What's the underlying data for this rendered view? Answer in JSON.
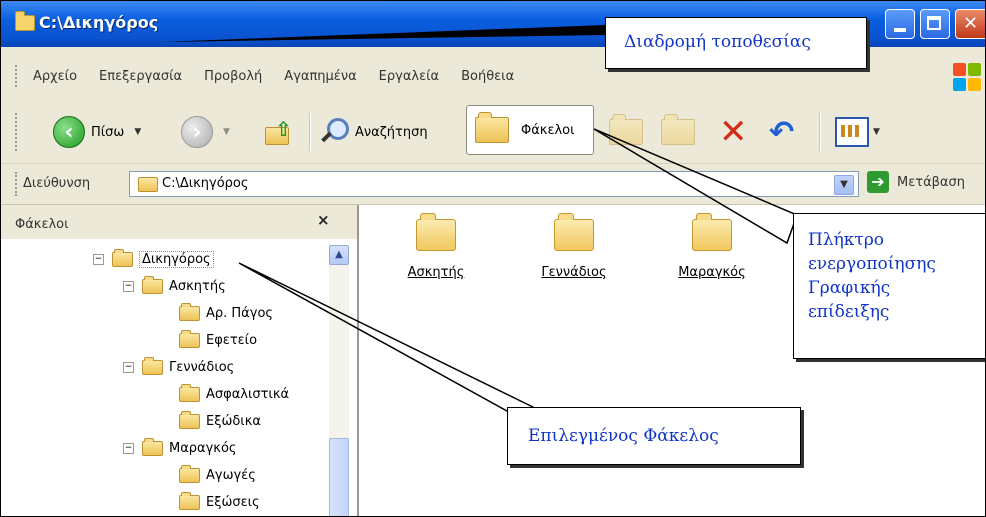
{
  "window": {
    "title": "C:\\Δικηγόρος"
  },
  "menu": {
    "items": [
      "Αρχείο",
      "Επεξεργασία",
      "Προβολή",
      "Αγαπημένα",
      "Εργαλεία",
      "Βοήθεια"
    ]
  },
  "toolbar": {
    "back_label": "Πίσω",
    "search_label": "Αναζήτηση",
    "folders_label": "Φάκελοι"
  },
  "address": {
    "label": "Διεύθυνση",
    "value": "C:\\Δικηγόρος",
    "go_label": "Μετάβαση"
  },
  "folders_pane": {
    "title": "Φάκελοι",
    "close_glyph": "×",
    "tree": [
      {
        "label": "Δικηγόρος",
        "expander": "−",
        "selected": true
      },
      {
        "label": "Ασκητής",
        "expander": "−"
      },
      {
        "label": "Αρ. Πάγος"
      },
      {
        "label": "Εφετείο"
      },
      {
        "label": "Γεννάδιος",
        "expander": "−"
      },
      {
        "label": "Ασφαλιστικά"
      },
      {
        "label": "Εξώδικα"
      },
      {
        "label": "Μαραγκός",
        "expander": "−"
      },
      {
        "label": "Αγωγές"
      },
      {
        "label": "Εξώσεις"
      }
    ]
  },
  "content": {
    "items": [
      "Ασκητής",
      "Γεννάδιος",
      "Μαραγκός"
    ]
  },
  "callouts": {
    "location_path": "Διαδρομή τοποθεσίας",
    "folders_button": [
      "Πλήκτρο",
      "ενεργοποίησης",
      "Γραφικής",
      "επίδειξης"
    ],
    "selected_folder": "Επιλεγμένος Φάκελος"
  },
  "colors": {
    "titlebar": "#0A5FE0",
    "callout_text": "#1034C8",
    "window_bg": "#ECE9D8"
  }
}
